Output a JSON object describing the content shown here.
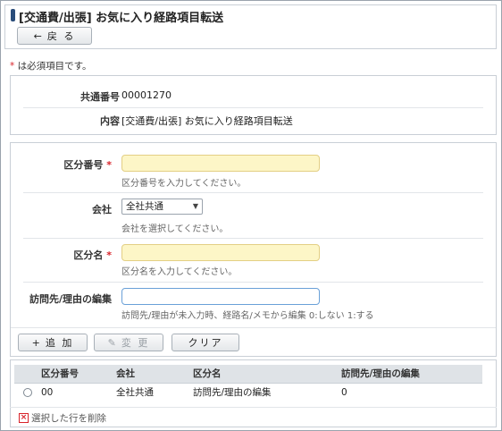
{
  "header": {
    "title": "[交通費/出張] お気に入り経路項目転送",
    "back_label": "戻 る"
  },
  "required_note": "は必須項目です。",
  "info": {
    "common_no_label": "共通番号",
    "common_no_value": "00001270",
    "content_label": "内容",
    "content_value": "[交通費/出張] お気に入り経路項目転送"
  },
  "form": {
    "division_no_label": "区分番号",
    "division_no_value": "",
    "division_no_hint": "区分番号を入力してください。",
    "company_label": "会社",
    "company_value": "全社共通",
    "company_hint": "会社を選択してください。",
    "division_name_label": "区分名",
    "division_name_value": "",
    "division_name_hint": "区分名を入力してください。",
    "visit_edit_label": "訪問先/理由の編集",
    "visit_edit_value": "",
    "visit_edit_hint": "訪問先/理由が未入力時、経路名/メモから編集 0:しない 1:する"
  },
  "actions": {
    "add_label": "追 加",
    "change_label": "変 更",
    "clear_label": "クリア"
  },
  "table": {
    "headers": [
      "区分番号",
      "会社",
      "区分名",
      "訪問先/理由の編集"
    ],
    "rows": [
      [
        "00",
        "全社共通",
        "訪問先/理由の編集",
        "0"
      ]
    ]
  },
  "delete_selected_label": "選択した行を削除",
  "colors": {
    "accent": "#2a4d7a",
    "required_star": "#d8232a",
    "required_field_bg": "#fdf6c7"
  }
}
